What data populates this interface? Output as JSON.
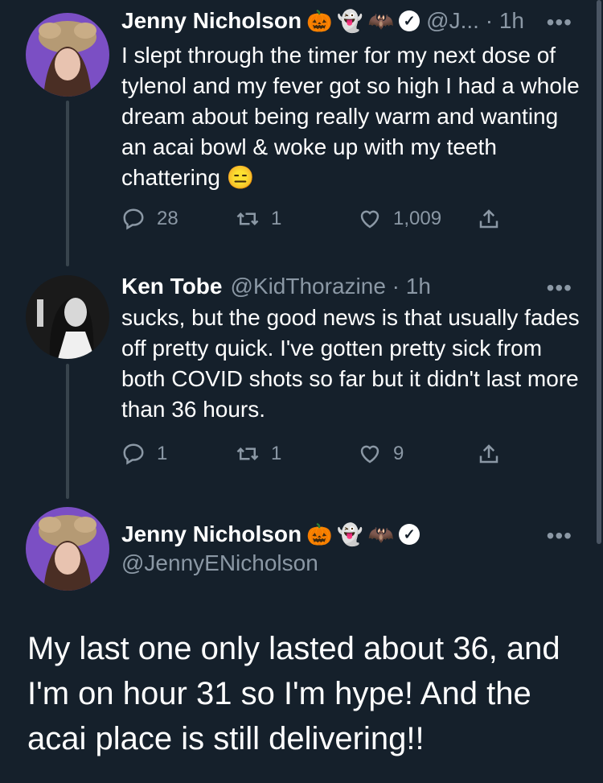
{
  "tweet1": {
    "name": "Jenny Nicholson",
    "badges": [
      "🎃",
      "👻",
      "🦇"
    ],
    "handle_time": "@J... · 1h",
    "text": "I slept through the timer for my next dose of tylenol and my fever got so high I had a whole dream about being really warm and wanting an acai bowl & woke up with my teeth chattering 😑",
    "replies": "28",
    "retweets": "1",
    "likes": "1,009"
  },
  "tweet2": {
    "name": "Ken Tobe",
    "handle_time": "@KidThorazine · 1h",
    "text": "sucks, but the good news is that usually fades off pretty quick.  I've gotten pretty sick from both COVID shots so far but it didn't last more than 36 hours.",
    "replies": "1",
    "retweets": "1",
    "likes": "9"
  },
  "tweet3": {
    "name": "Jenny Nicholson",
    "badges": [
      "🎃",
      "👻",
      "🦇"
    ],
    "handle": "@JennyENicholson",
    "text": "My last one only lasted about 36, and I'm on hour 31 so I'm hype! And the acai place is still delivering!!"
  },
  "more_label": "•••",
  "colors": {
    "background": "#15202b",
    "muted": "#8b98a5",
    "line": "#38444d"
  }
}
